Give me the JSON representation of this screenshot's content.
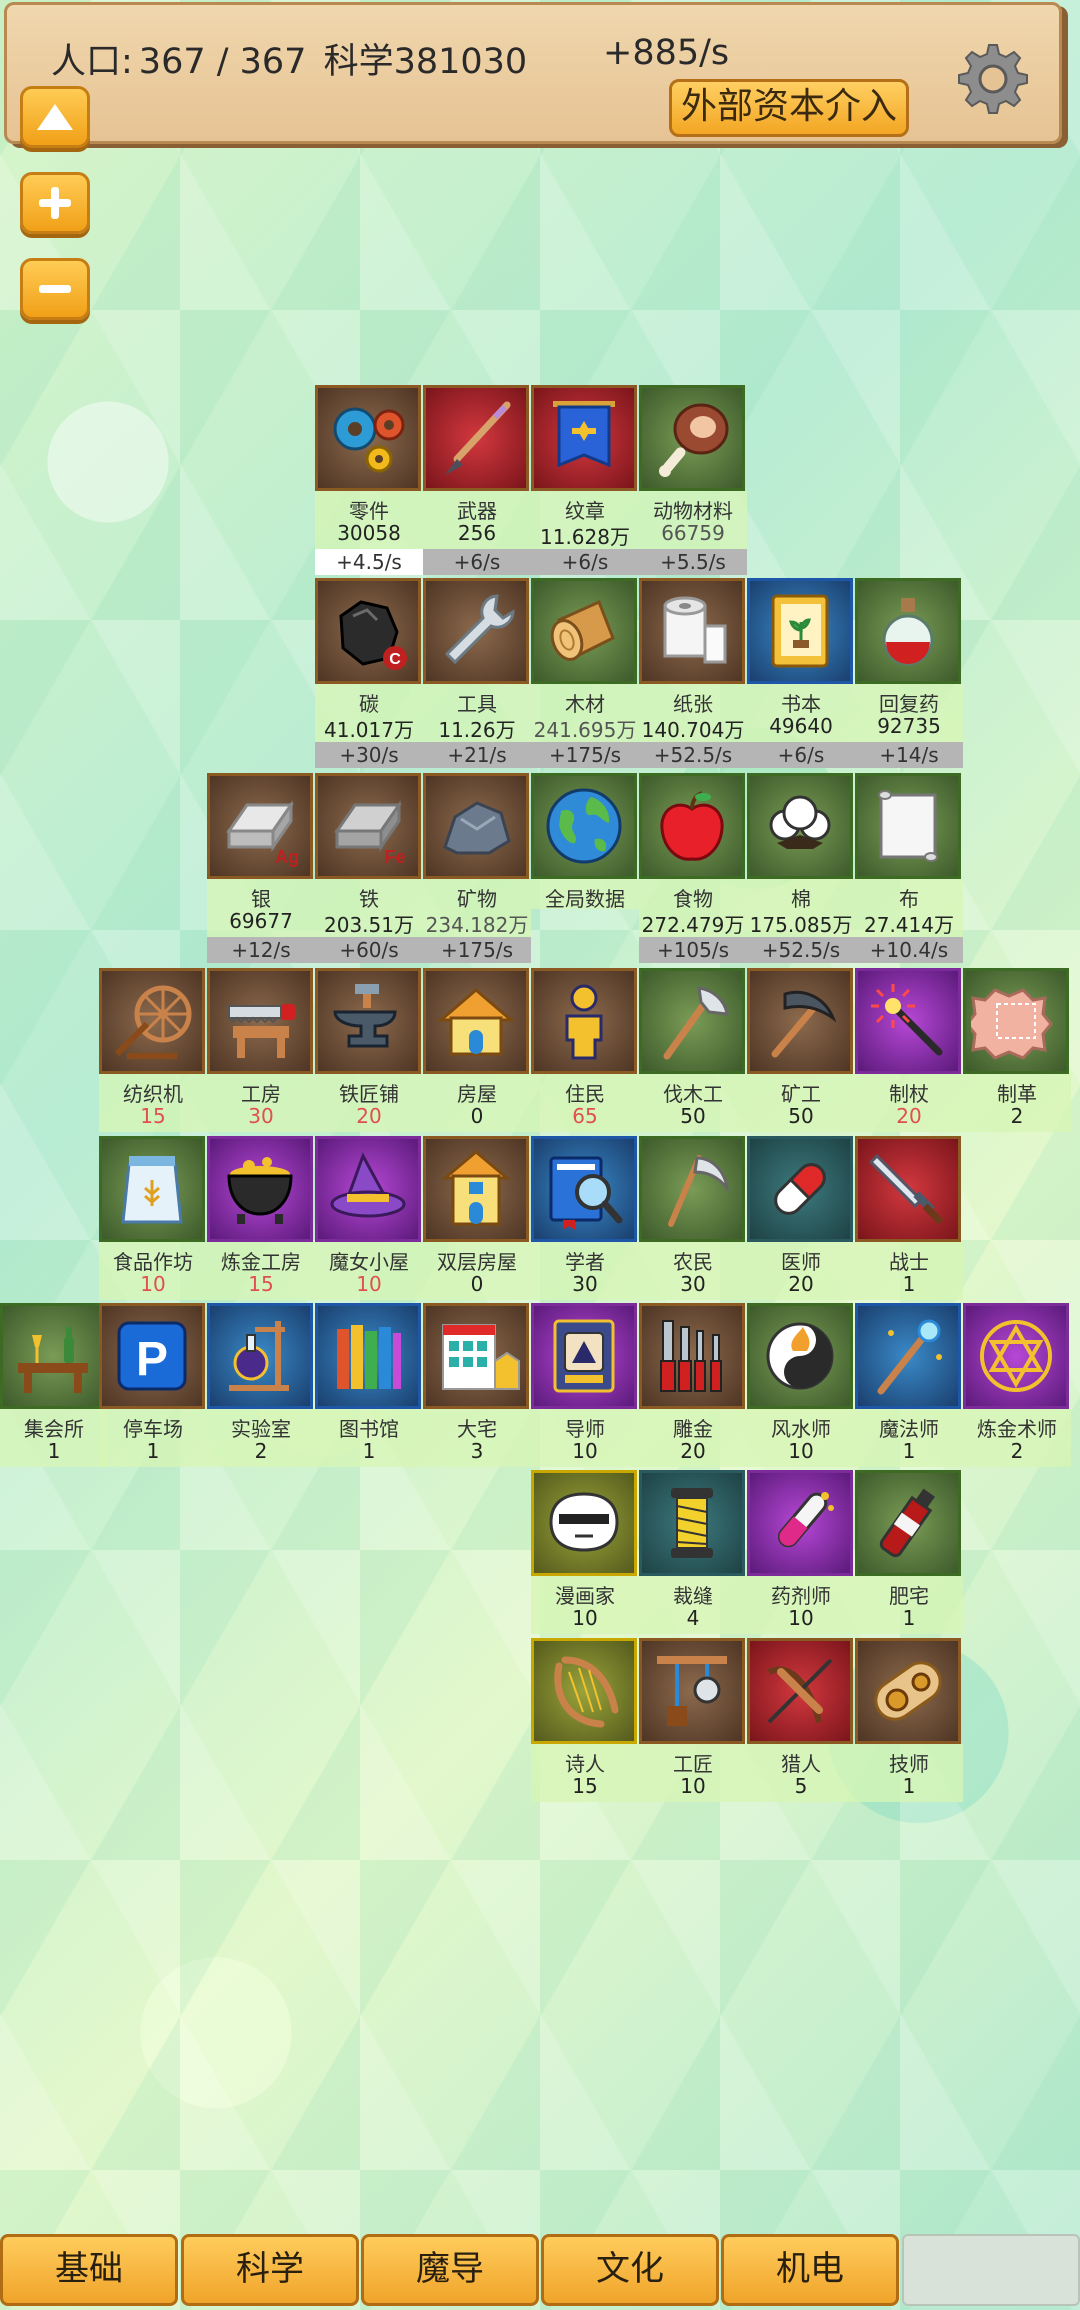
{
  "header": {
    "population_label": "人口:",
    "population_value": "367 / 367",
    "science_label": "科学381030",
    "rate": "+885/s",
    "capital_button": "外部资本介入"
  },
  "tiles": {
    "parts": {
      "name": "零件",
      "count": "30058",
      "rate": "+4.5/s"
    },
    "weapons": {
      "name": "武器",
      "count": "256",
      "rate": "+6/s"
    },
    "emblem": {
      "name": "纹章",
      "count": "11.628万",
      "rate": "+6/s"
    },
    "animal": {
      "name": "动物材料",
      "count": "66759",
      "rate": "+5.5/s"
    },
    "carbon": {
      "name": "碳",
      "count": "41.017万",
      "rate": "+30/s"
    },
    "tools": {
      "name": "工具",
      "count": "11.26万",
      "rate": "+21/s"
    },
    "wood": {
      "name": "木材",
      "count": "241.695万",
      "rate": "+175/s"
    },
    "paper": {
      "name": "纸张",
      "count": "140.704万",
      "rate": "+52.5/s"
    },
    "book": {
      "name": "书本",
      "count": "49640",
      "rate": "+6/s"
    },
    "potion": {
      "name": "回复药",
      "count": "92735",
      "rate": "+14/s"
    },
    "silver": {
      "name": "银",
      "count": "69677",
      "rate": "+12/s"
    },
    "iron": {
      "name": "铁",
      "count": "203.51万",
      "rate": "+60/s"
    },
    "ore": {
      "name": "矿物",
      "count": "234.182万",
      "rate": "+175/s"
    },
    "globe": {
      "name": "全局数据"
    },
    "food": {
      "name": "食物",
      "count": "272.479万",
      "rate": "+105/s"
    },
    "cotton": {
      "name": "棉",
      "count": "175.085万",
      "rate": "+52.5/s"
    },
    "cloth": {
      "name": "布",
      "count": "27.414万",
      "rate": "+10.4/s"
    },
    "loom": {
      "name": "纺织机",
      "count": "15"
    },
    "workshop": {
      "name": "工房",
      "count": "30"
    },
    "smithy": {
      "name": "铁匠铺",
      "count": "20"
    },
    "house": {
      "name": "房屋",
      "count": "0"
    },
    "resident": {
      "name": "住民",
      "count": "65"
    },
    "lumberjack": {
      "name": "伐木工",
      "count": "50"
    },
    "miner": {
      "name": "矿工",
      "count": "50"
    },
    "staffmaker": {
      "name": "制杖",
      "count": "20"
    },
    "tanner": {
      "name": "制革",
      "count": "2"
    },
    "foodshop": {
      "name": "食品作坊",
      "count": "10"
    },
    "alchemyhouse": {
      "name": "炼金工房",
      "count": "15"
    },
    "witchhut": {
      "name": "魔女小屋",
      "count": "10"
    },
    "duplex": {
      "name": "双层房屋",
      "count": "0"
    },
    "scholar": {
      "name": "学者",
      "count": "30"
    },
    "farmer": {
      "name": "农民",
      "count": "30"
    },
    "doctor": {
      "name": "医师",
      "count": "20"
    },
    "warrior": {
      "name": "战士",
      "count": "1"
    },
    "hall": {
      "name": "集会所",
      "count": "1"
    },
    "parking": {
      "name": "停车场",
      "count": "1"
    },
    "lab": {
      "name": "实验室",
      "count": "2"
    },
    "library": {
      "name": "图书馆",
      "count": "1"
    },
    "mansion": {
      "name": "大宅",
      "count": "3"
    },
    "mentor": {
      "name": "导师",
      "count": "10"
    },
    "engraver": {
      "name": "雕金",
      "count": "20"
    },
    "fengshui": {
      "name": "风水师",
      "count": "10"
    },
    "mage": {
      "name": "魔法师",
      "count": "1"
    },
    "alchemist": {
      "name": "炼金术师",
      "count": "2"
    },
    "artist": {
      "name": "漫画家",
      "count": "10"
    },
    "tailor": {
      "name": "裁缝",
      "count": "4"
    },
    "pharmacist": {
      "name": "药剂师",
      "count": "10"
    },
    "otaku": {
      "name": "肥宅",
      "count": "1"
    },
    "poet": {
      "name": "诗人",
      "count": "15"
    },
    "craftsman": {
      "name": "工匠",
      "count": "10"
    },
    "hunter": {
      "name": "猎人",
      "count": "5"
    },
    "technician": {
      "name": "技师",
      "count": "1"
    }
  },
  "tabs": [
    "基础",
    "科学",
    "魔导",
    "文化",
    "机电"
  ],
  "colors": {
    "accent": "#f3a623",
    "tab": "#ffcc5c",
    "background": "#c8f0d2",
    "red_count": "#e05050"
  }
}
